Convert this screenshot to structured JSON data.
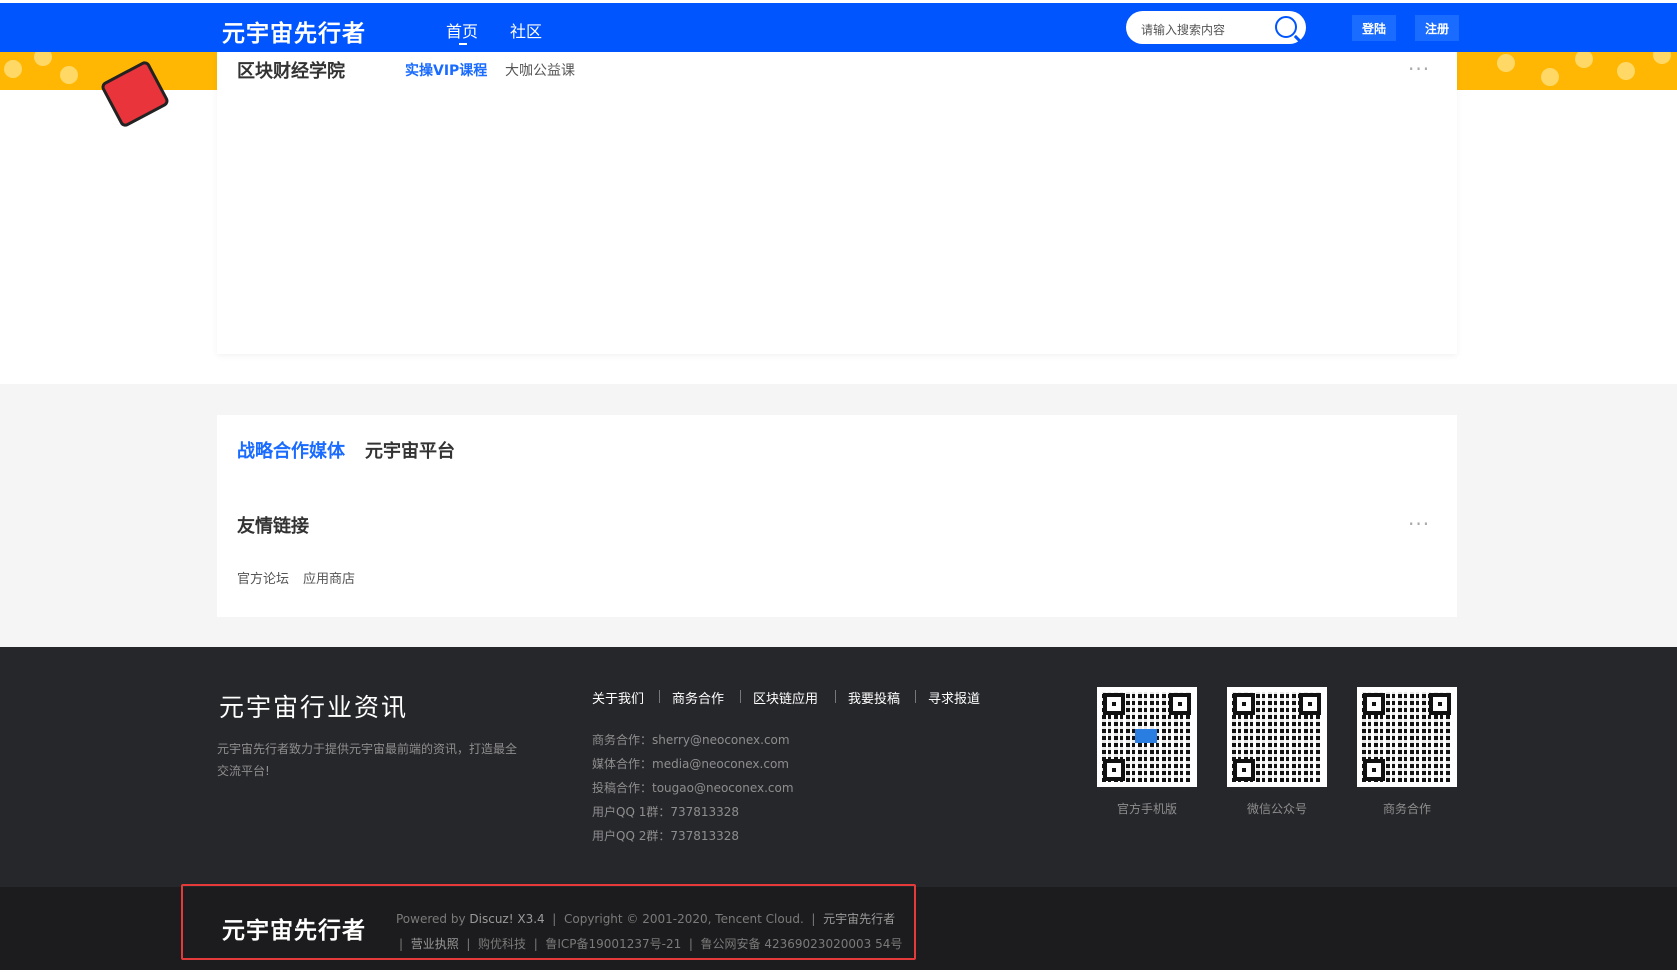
{
  "header": {
    "logo": "元宇宙先行者",
    "nav": [
      {
        "label": "首页"
      },
      {
        "label": "社区"
      }
    ],
    "search_placeholder": "请输入搜索内容",
    "login": "登陆",
    "register": "注册"
  },
  "section1": {
    "title": "区块财经学院",
    "tabs": [
      {
        "label": "实操VIP课程"
      },
      {
        "label": "大咖公益课"
      }
    ],
    "more": "···"
  },
  "section2": {
    "tabs": [
      {
        "label": "战略合作媒体"
      },
      {
        "label": "元宇宙平台"
      }
    ],
    "friend_title": "友情链接",
    "more": "···",
    "links": [
      {
        "label": "官方论坛"
      },
      {
        "label": "应用商店"
      }
    ]
  },
  "footer": {
    "title": "元宇宙行业资讯",
    "desc": "元宇宙先行者致力于提供元宇宙最前端的资讯，打造最全交流平台!",
    "links": [
      {
        "label": "关于我们"
      },
      {
        "label": "商务合作"
      },
      {
        "label": "区块链应用"
      },
      {
        "label": "我要投稿"
      },
      {
        "label": "寻求报道"
      }
    ],
    "contacts": [
      {
        "text": "商务合作：sherry@neoconex.com"
      },
      {
        "text": "媒体合作：media@neoconex.com"
      },
      {
        "text": "投稿合作：tougao@neoconex.com"
      },
      {
        "text": "用户QQ 1群：737813328"
      },
      {
        "text": "用户QQ 2群：737813328"
      }
    ],
    "qrcodes": [
      {
        "label": "官方手机版"
      },
      {
        "label": "微信公众号"
      },
      {
        "label": "商务合作"
      }
    ]
  },
  "bottom": {
    "logo": "元宇宙先行者",
    "powered": "Powered by",
    "discuz": "Discuz! X3.4",
    "copyright": "Copyright © 2001-2020, Tencent Cloud.",
    "site": "元宇宙先行者",
    "license": "营业执照",
    "company": "购优科技",
    "icp": "鲁ICP备19001237号-21",
    "police": "鲁公网安备 42369023020003 54号"
  },
  "colors": {
    "accent": "#0055ff",
    "footer": "#26272b",
    "highlight": "#e53a3a"
  }
}
